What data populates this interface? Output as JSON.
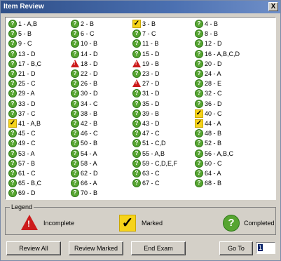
{
  "window": {
    "title": "Item Review",
    "close_label": "X"
  },
  "items": [
    [
      {
        "label": "1 - A,B",
        "status": "completed"
      },
      {
        "label": "5 - B",
        "status": "completed"
      },
      {
        "label": "9 - C",
        "status": "completed"
      },
      {
        "label": "13 - D",
        "status": "completed"
      },
      {
        "label": "17 - B,C",
        "status": "completed"
      },
      {
        "label": "21 - D",
        "status": "completed"
      },
      {
        "label": "25 - C",
        "status": "completed"
      },
      {
        "label": "29 - A",
        "status": "completed"
      },
      {
        "label": "33 - D",
        "status": "completed"
      },
      {
        "label": "37 - C",
        "status": "completed"
      },
      {
        "label": "41 - A,B",
        "status": "marked"
      },
      {
        "label": "45 - C",
        "status": "completed"
      },
      {
        "label": "49 - C",
        "status": "completed"
      },
      {
        "label": "53 - A",
        "status": "completed"
      },
      {
        "label": "57 - B",
        "status": "completed"
      },
      {
        "label": "61 - C",
        "status": "completed"
      },
      {
        "label": "65 - B,C",
        "status": "completed"
      },
      {
        "label": "69 - D",
        "status": "completed"
      }
    ],
    [
      {
        "label": "2 - B",
        "status": "completed"
      },
      {
        "label": "6 - C",
        "status": "completed"
      },
      {
        "label": "10 - B",
        "status": "completed"
      },
      {
        "label": "14 - D",
        "status": "completed"
      },
      {
        "label": "18 - D",
        "status": "incomplete"
      },
      {
        "label": "22 - D",
        "status": "completed"
      },
      {
        "label": "26 - B",
        "status": "completed"
      },
      {
        "label": "30 - D",
        "status": "completed"
      },
      {
        "label": "34 - C",
        "status": "completed"
      },
      {
        "label": "38 - B",
        "status": "completed"
      },
      {
        "label": "42 - B",
        "status": "completed"
      },
      {
        "label": "46 - C",
        "status": "completed"
      },
      {
        "label": "50 - B",
        "status": "completed"
      },
      {
        "label": "54 - A",
        "status": "completed"
      },
      {
        "label": "58 - A",
        "status": "completed"
      },
      {
        "label": "62 - D",
        "status": "completed"
      },
      {
        "label": "66 - A",
        "status": "completed"
      },
      {
        "label": "70 - B",
        "status": "completed"
      }
    ],
    [
      {
        "label": "3 - B",
        "status": "marked"
      },
      {
        "label": "7 - C",
        "status": "completed"
      },
      {
        "label": "11 - B",
        "status": "completed"
      },
      {
        "label": "15 - D",
        "status": "completed"
      },
      {
        "label": "19 - B",
        "status": "incomplete"
      },
      {
        "label": "23 - D",
        "status": "completed"
      },
      {
        "label": "27 - D",
        "status": "incomplete"
      },
      {
        "label": "31 - D",
        "status": "completed"
      },
      {
        "label": "35 - D",
        "status": "completed"
      },
      {
        "label": "39 - B",
        "status": "completed"
      },
      {
        "label": "43 - D",
        "status": "completed"
      },
      {
        "label": "47 - C",
        "status": "completed"
      },
      {
        "label": "51 - C,D",
        "status": "completed"
      },
      {
        "label": "55 - A,B",
        "status": "completed"
      },
      {
        "label": "59 - C,D,E,F",
        "status": "completed"
      },
      {
        "label": "63 - C",
        "status": "completed"
      },
      {
        "label": "67 - C",
        "status": "completed"
      }
    ],
    [
      {
        "label": "4 - B",
        "status": "completed"
      },
      {
        "label": "8 - B",
        "status": "completed"
      },
      {
        "label": "12 - D",
        "status": "completed"
      },
      {
        "label": "16 - A,B,C,D",
        "status": "completed"
      },
      {
        "label": "20 - D",
        "status": "completed"
      },
      {
        "label": "24 - A",
        "status": "completed"
      },
      {
        "label": "28 - E",
        "status": "completed"
      },
      {
        "label": "32 - C",
        "status": "completed"
      },
      {
        "label": "36 - D",
        "status": "completed"
      },
      {
        "label": "40 - C",
        "status": "marked"
      },
      {
        "label": "44 - A",
        "status": "marked"
      },
      {
        "label": "48 - B",
        "status": "completed"
      },
      {
        "label": "52 - B",
        "status": "completed"
      },
      {
        "label": "56 - A,B,C",
        "status": "completed"
      },
      {
        "label": "60 - C",
        "status": "completed"
      },
      {
        "label": "64 - A",
        "status": "completed"
      },
      {
        "label": "68 - B",
        "status": "completed"
      }
    ]
  ],
  "legend": {
    "title": "Legend",
    "incomplete": "Incomplete",
    "marked": "Marked",
    "completed": "Completed"
  },
  "buttons": {
    "review_all": "Review All",
    "review_marked": "Review Marked",
    "end_exam": "End Exam",
    "go_to": "Go To"
  },
  "goto_value": "1",
  "colors": {
    "completed": "#57a531",
    "incomplete": "#cc1b1b",
    "marked": "#f6d31a",
    "titlebar": "#2f4f88"
  },
  "icons": {
    "completed": "question-circle-icon",
    "incomplete": "warning-triangle-icon",
    "marked": "check-mark-icon"
  }
}
